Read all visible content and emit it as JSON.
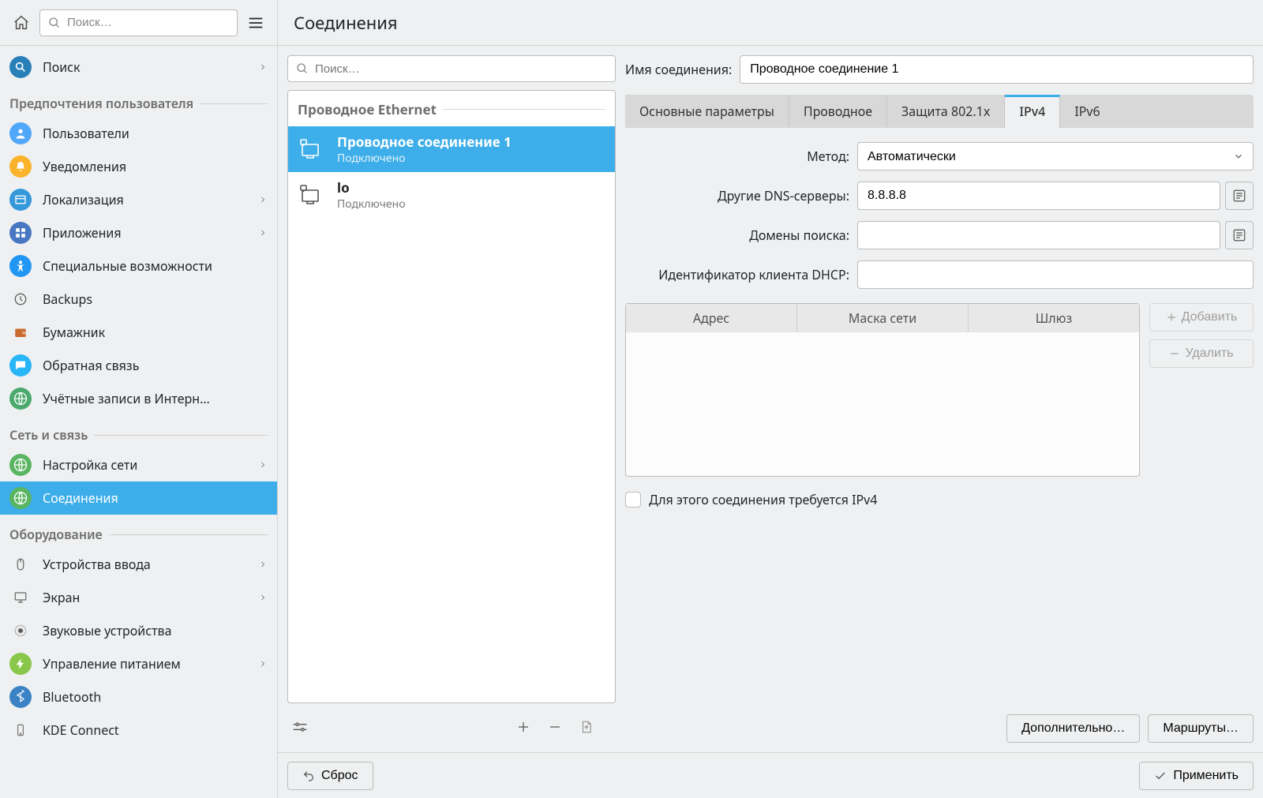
{
  "header": {
    "search_placeholder": "Поиск…"
  },
  "sidebar": {
    "top_item": {
      "label": "Поиск",
      "expandable": true
    },
    "sections": [
      {
        "title": "Предпочтения пользователя",
        "items": [
          {
            "id": "users",
            "label": "Пользователи",
            "icon_class": "ic-users",
            "expandable": false
          },
          {
            "id": "notifications",
            "label": "Уведомления",
            "icon_class": "ic-notif",
            "expandable": false
          },
          {
            "id": "locale",
            "label": "Локализация",
            "icon_class": "ic-locale",
            "expandable": true
          },
          {
            "id": "applications",
            "label": "Приложения",
            "icon_class": "ic-apps",
            "expandable": true
          },
          {
            "id": "a11y",
            "label": "Специальные возможности",
            "icon_class": "ic-a11y",
            "expandable": false
          },
          {
            "id": "backups",
            "label": "Backups",
            "icon_class": "ic-backup",
            "expandable": false
          },
          {
            "id": "wallet",
            "label": "Бумажник",
            "icon_class": "ic-wallet",
            "expandable": false
          },
          {
            "id": "feedback",
            "label": "Обратная связь",
            "icon_class": "ic-feedback",
            "expandable": false
          },
          {
            "id": "online-accounts",
            "label": "Учётные записи в Интерн…",
            "icon_class": "ic-online",
            "expandable": false
          }
        ]
      },
      {
        "title": "Сеть и связь",
        "items": [
          {
            "id": "network-settings",
            "label": "Настройка сети",
            "icon_class": "ic-netset",
            "expandable": true
          },
          {
            "id": "connections",
            "label": "Соединения",
            "icon_class": "ic-conn",
            "expandable": false,
            "active": true
          }
        ]
      },
      {
        "title": "Оборудование",
        "items": [
          {
            "id": "input-devices",
            "label": "Устройства ввода",
            "icon_class": "ic-input",
            "expandable": true
          },
          {
            "id": "display",
            "label": "Экран",
            "icon_class": "ic-display",
            "expandable": true
          },
          {
            "id": "sound",
            "label": "Звуковые устройства",
            "icon_class": "ic-sound",
            "expandable": false
          },
          {
            "id": "power",
            "label": "Управление питанием",
            "icon_class": "ic-power",
            "expandable": true
          },
          {
            "id": "bluetooth",
            "label": "Bluetooth",
            "icon_class": "ic-bt",
            "expandable": false
          },
          {
            "id": "kde-connect",
            "label": "KDE Connect",
            "icon_class": "ic-kde",
            "expandable": false
          }
        ]
      }
    ]
  },
  "page": {
    "title": "Соединения"
  },
  "conn_panel": {
    "search_placeholder": "Поиск…",
    "group_title": "Проводное Ethernet",
    "items": [
      {
        "title": "Проводное соединение 1",
        "sub": "Подключено",
        "active": true
      },
      {
        "title": "lo",
        "sub": "Подключено",
        "active": false
      }
    ]
  },
  "settings": {
    "name_label": "Имя соединения:",
    "name_value": "Проводное соединение 1",
    "tabs": [
      {
        "id": "general",
        "label": "Основные параметры"
      },
      {
        "id": "wired",
        "label": "Проводное"
      },
      {
        "id": "8021x",
        "label": "Защита 802.1x"
      },
      {
        "id": "ipv4",
        "label": "IPv4",
        "active": true
      },
      {
        "id": "ipv6",
        "label": "IPv6"
      }
    ],
    "ipv4": {
      "method_label": "Метод:",
      "method_value": "Автоматически",
      "dns_label": "Другие DNS-серверы:",
      "dns_value": "8.8.8.8",
      "search_label": "Домены поиска:",
      "search_value": "",
      "dhcp_client_label": "Идентификатор клиента DHCP:",
      "dhcp_client_value": "",
      "table_headers": {
        "address": "Адрес",
        "netmask": "Маска сети",
        "gateway": "Шлюз"
      },
      "add_label": "Добавить",
      "remove_label": "Удалить",
      "require_ipv4_label": "Для этого соединения требуется IPv4",
      "advanced_label": "Дополнительно…",
      "routes_label": "Маршруты…"
    }
  },
  "footer": {
    "reset_label": "Сброс",
    "apply_label": "Применить"
  }
}
